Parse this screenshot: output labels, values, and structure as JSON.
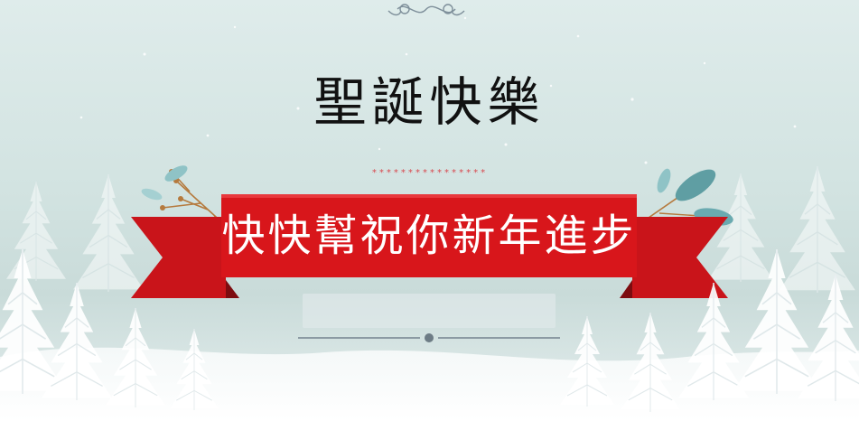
{
  "card": {
    "title": "聖誕快樂",
    "stars": "****************",
    "banner_text": "快快幫祝你新年進步"
  },
  "colors": {
    "sky": "#d3e3e2",
    "banner_red": "#d8161b",
    "banner_dark_red": "#9a1015",
    "title_ink": "#111111",
    "star_red": "#d8494f",
    "tree_white": "#ffffff",
    "leaf_teal": "#5f9ea3",
    "twig_brown": "#b57a3e"
  },
  "decorations": {
    "top_ornament": "flourish-icon",
    "bottom_ornament": "snowflake-icon",
    "left_sprig": "twig-sprig-icon",
    "right_sprig": "leaf-sprig-icon"
  }
}
